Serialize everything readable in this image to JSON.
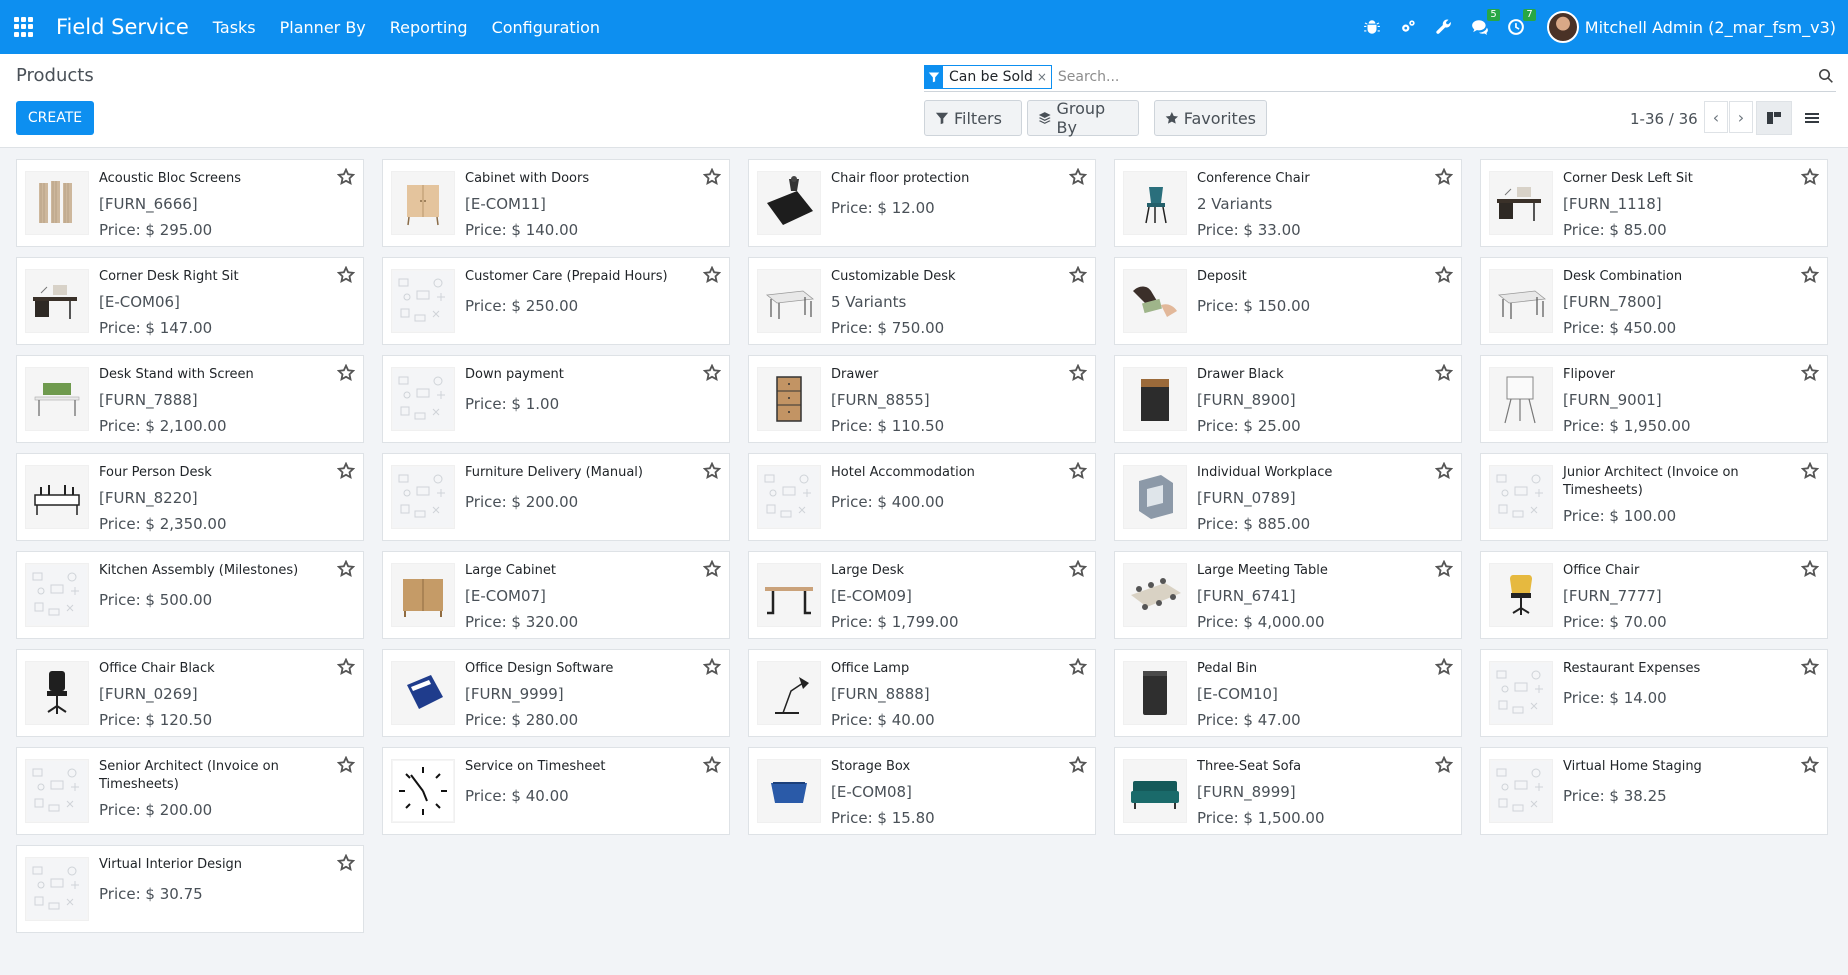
{
  "navbar": {
    "brand": "Field Service",
    "menu": [
      "Tasks",
      "Planner By",
      "Reporting",
      "Configuration"
    ],
    "messages_count": "5",
    "activities_count": "7",
    "user": "Mitchell Admin (2_mar_fsm_v3)"
  },
  "control": {
    "breadcrumb": "Products",
    "create_label": "CREATE",
    "facet_label": "Can be Sold",
    "facet_close": "×",
    "search_placeholder": "Search...",
    "filters_label": "Filters",
    "groupby_label": "Group By",
    "favorites_label": "Favorites",
    "pager": "1-36 / 36"
  },
  "products": [
    {
      "name": "Acoustic Bloc Screens",
      "ref": "[FURN_6666]",
      "price": "Price: $ 295.00",
      "img": "screens"
    },
    {
      "name": "Cabinet with Doors",
      "ref": "[E-COM11]",
      "price": "Price: $ 140.00",
      "img": "cabinet"
    },
    {
      "name": "Chair floor protection",
      "ref": "",
      "price": "Price: $ 12.00",
      "img": "mat"
    },
    {
      "name": "Conference Chair",
      "ref": "2 Variants",
      "price": "Price: $ 33.00",
      "img": "chair-teal"
    },
    {
      "name": "Corner Desk Left Sit",
      "ref": "[FURN_1118]",
      "price": "Price: $ 85.00",
      "img": "desk-dark"
    },
    {
      "name": "Corner Desk Right Sit",
      "ref": "[E-COM06]",
      "price": "Price: $ 147.00",
      "img": "desk-dark"
    },
    {
      "name": "Customer Care (Prepaid Hours)",
      "ref": "",
      "price": "Price: $ 250.00",
      "img": "placeholder"
    },
    {
      "name": "Customizable Desk",
      "ref": "5 Variants",
      "price": "Price: $ 750.00",
      "img": "desk-white"
    },
    {
      "name": "Deposit",
      "ref": "",
      "price": "Price: $ 150.00",
      "img": "money"
    },
    {
      "name": "Desk Combination",
      "ref": "[FURN_7800]",
      "price": "Price: $ 450.00",
      "img": "desk-white"
    },
    {
      "name": "Desk Stand with Screen",
      "ref": "[FURN_7888]",
      "price": "Price: $ 2,100.00",
      "img": "desk-green"
    },
    {
      "name": "Down payment",
      "ref": "",
      "price": "Price: $ 1.00",
      "img": "placeholder"
    },
    {
      "name": "Drawer",
      "ref": "[FURN_8855]",
      "price": "Price: $ 110.50",
      "img": "drawer-wood"
    },
    {
      "name": "Drawer Black",
      "ref": "[FURN_8900]",
      "price": "Price: $ 25.00",
      "img": "drawer-black"
    },
    {
      "name": "Flipover",
      "ref": "[FURN_9001]",
      "price": "Price: $ 1,950.00",
      "img": "flipover"
    },
    {
      "name": "Four Person Desk",
      "ref": "[FURN_8220]",
      "price": "Price: $ 2,350.00",
      "img": "four-desk"
    },
    {
      "name": "Furniture Delivery (Manual)",
      "ref": "",
      "price": "Price: $ 200.00",
      "img": "placeholder"
    },
    {
      "name": "Hotel Accommodation",
      "ref": "",
      "price": "Price: $ 400.00",
      "img": "placeholder"
    },
    {
      "name": "Individual Workplace",
      "ref": "[FURN_0789]",
      "price": "Price: $ 885.00",
      "img": "workplace"
    },
    {
      "name": "Junior Architect (Invoice on Timesheets)",
      "ref": "",
      "price": "Price: $ 100.00",
      "img": "placeholder"
    },
    {
      "name": "Kitchen Assembly (Milestones)",
      "ref": "",
      "price": "Price: $ 500.00",
      "img": "placeholder"
    },
    {
      "name": "Large Cabinet",
      "ref": "[E-COM07]",
      "price": "Price: $ 320.00",
      "img": "cabinet-large"
    },
    {
      "name": "Large Desk",
      "ref": "[E-COM09]",
      "price": "Price: $ 1,799.00",
      "img": "large-desk"
    },
    {
      "name": "Large Meeting Table",
      "ref": "[FURN_6741]",
      "price": "Price: $ 4,000.00",
      "img": "meeting-table"
    },
    {
      "name": "Office Chair",
      "ref": "[FURN_7777]",
      "price": "Price: $ 70.00",
      "img": "chair-yellow"
    },
    {
      "name": "Office Chair Black",
      "ref": "[FURN_0269]",
      "price": "Price: $ 120.50",
      "img": "chair-black"
    },
    {
      "name": "Office Design Software",
      "ref": "[FURN_9999]",
      "price": "Price: $ 280.00",
      "img": "software"
    },
    {
      "name": "Office Lamp",
      "ref": "[FURN_8888]",
      "price": "Price: $ 40.00",
      "img": "lamp"
    },
    {
      "name": "Pedal Bin",
      "ref": "[E-COM10]",
      "price": "Price: $ 47.00",
      "img": "bin"
    },
    {
      "name": "Restaurant Expenses",
      "ref": "",
      "price": "Price: $ 14.00",
      "img": "placeholder"
    },
    {
      "name": "Senior Architect (Invoice on Timesheets)",
      "ref": "",
      "price": "Price: $ 200.00",
      "img": "placeholder"
    },
    {
      "name": "Service on Timesheet",
      "ref": "",
      "price": "Price: $ 40.00",
      "img": "clock"
    },
    {
      "name": "Storage Box",
      "ref": "[E-COM08]",
      "price": "Price: $ 15.80",
      "img": "box"
    },
    {
      "name": "Three-Seat Sofa",
      "ref": "[FURN_8999]",
      "price": "Price: $ 1,500.00",
      "img": "sofa"
    },
    {
      "name": "Virtual Home Staging",
      "ref": "",
      "price": "Price: $ 38.25",
      "img": "placeholder"
    },
    {
      "name": "Virtual Interior Design",
      "ref": "",
      "price": "Price: $ 30.75",
      "img": "placeholder"
    }
  ],
  "colors": {
    "navbar": "#0d8ff0",
    "background": "#f2f4f7",
    "badge": "#28a745"
  }
}
